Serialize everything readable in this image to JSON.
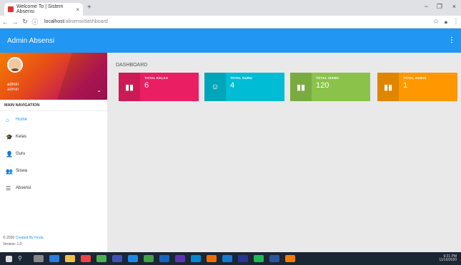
{
  "browser": {
    "tab_title": "Welcome To | Sistem Absensi",
    "tab_close": "×",
    "new_tab": "+",
    "url_host": "localhost",
    "url_path": "/absensi/dashboard",
    "window_controls": [
      "−",
      "❐",
      "×"
    ]
  },
  "appbar": {
    "title": "Admin Absensi",
    "menu_glyph": "⋮"
  },
  "user": {
    "name": "admin",
    "email": "admin"
  },
  "sidebar": {
    "heading": "MAIN NAVIGATION",
    "items": [
      {
        "label": "Home",
        "icon": "home-icon",
        "glyph": "⌂",
        "active": true
      },
      {
        "label": "Kelas",
        "icon": "school-icon",
        "glyph": "🎓",
        "active": false
      },
      {
        "label": "Guru",
        "icon": "person-icon",
        "glyph": "👤",
        "active": false
      },
      {
        "label": "Siswa",
        "icon": "people-icon",
        "glyph": "👥",
        "active": false
      },
      {
        "label": "Absensi",
        "icon": "list-icon",
        "glyph": "☰",
        "active": false
      }
    ],
    "legal_prefix": "© 2020",
    "legal_link": "Created By Finda.",
    "version": "Version: 1.0"
  },
  "main": {
    "title": "DASHBOARD",
    "cards": [
      {
        "label": "TOTAL KELAS",
        "value": "6",
        "color": "#e91e63",
        "icon": "bar-chart-icon",
        "glyph": "▮"
      },
      {
        "label": "TOTAL GURU",
        "value": "4",
        "color": "#00bcd4",
        "icon": "face-icon",
        "glyph": "☺"
      },
      {
        "label": "TOTAL SISWA",
        "value": "120",
        "color": "#8bc34a",
        "icon": "bar-chart-icon",
        "glyph": "▮"
      },
      {
        "label": "TOTAL ADMIN",
        "value": "1",
        "color": "#ff9800",
        "icon": "bar-chart-icon",
        "glyph": "▮"
      }
    ]
  },
  "taskbar": {
    "time": "9:21 PM",
    "date": "11/10/2020"
  }
}
